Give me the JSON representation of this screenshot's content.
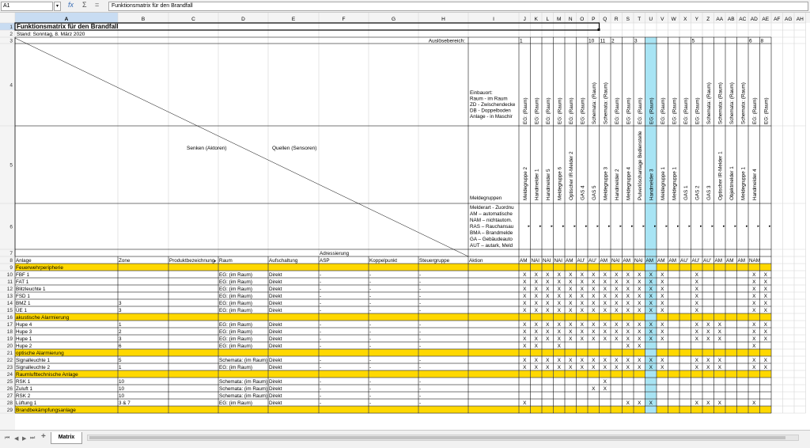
{
  "namebox": "A1",
  "formula": "Funktionsmatrix für den Brandfall",
  "tab": "Matrix",
  "columns": [
    "A",
    "B",
    "C",
    "D",
    "E",
    "F",
    "G",
    "H",
    "I",
    "J",
    "K",
    "L",
    "M",
    "N",
    "O",
    "P",
    "Q",
    "R",
    "S",
    "T",
    "U",
    "V",
    "W",
    "X",
    "Y",
    "Z",
    "AA",
    "AB",
    "AC",
    "AD",
    "AE",
    "AF",
    "AG",
    "AH"
  ],
  "selected_column": "A",
  "highlight_column": "U",
  "title": "Funktionsmatrix für den Brandfall",
  "stand": "Stand: Sonntag, 8. März 2020",
  "ausloese_label": "Auslösebereich:",
  "ausloese_values": {
    "J": "1",
    "P": "10",
    "Q": "11",
    "R": "2",
    "T": "3",
    "Y": "5",
    "AD": "6",
    "AE": "8"
  },
  "diag_labels": [
    "Senken (Aktoren)",
    "Quellen (Sensoren)"
  ],
  "einbauort": [
    "Einbauort:",
    "Raum - im Raum",
    "ZD - Zwischendecke",
    "DB - Doppelboden",
    "Anlage - in Maschir"
  ],
  "meldegruppen": "Meldegruppen",
  "melderart": [
    "Melderart - Zuordnu",
    "AM – automatische",
    "NAM – nichtautom.",
    "RAS – Rauchansau",
    "BMA – Brandmelde",
    "GA – Gebäudeauto",
    "AUT – autark, Meld"
  ],
  "adressierung": "Adressierung",
  "headers": {
    "A": "Anlage",
    "B": "Zone",
    "C": "Produktbezeichnung",
    "D": "Raum",
    "E": "Aufschaltung",
    "F": "ASP",
    "G": "Koppelpunkt",
    "H": "Steuergruppe",
    "I": "Aktion"
  },
  "row4": [
    "EG: (Raum)",
    "EG: (Raum)",
    "EG: (Raum)",
    "EG: (Raum)",
    "EG: (Raum)",
    "EG: (Raum)",
    "Schemata: (Raum)",
    "Schemata: (Raum)",
    "EG: (Raum)",
    "EG: (Raum)",
    "EG: (Raum)",
    "EG: (Raum)",
    "EG: (Raum)",
    "EG: (Raum)",
    "EG: (Raum)",
    "EG: (Raum)",
    "Schemata: (Raum)",
    "Schemata: (Raum)",
    "Schemata: (Raum)",
    "Schemata: (Raum)",
    "EG: (Raum)",
    "EG: (Raum)"
  ],
  "row5": [
    "Meldegruppe 2",
    "Handmelder 1",
    "Handmelder 5",
    "Meldegruppe 6",
    "Optischer IR-Melder 2",
    "GAS 4",
    "GAS 5",
    "Meldegruppe 3",
    "Handmelder 2",
    "Meldegruppe 4",
    "Pulverlöschanlage Bedienstelle",
    "Handmelder 3",
    "Meldegruppe 1",
    "Meldegruppe 1",
    "GAS 1",
    "GAS 2",
    "GAS 3",
    "Optischer IR-Melder 1",
    "Objektmelder 1",
    "Meldegruppe 1",
    "Handmelder 4"
  ],
  "row7": [
    "AM",
    "NAI",
    "NAI",
    "NAI",
    "AM",
    "AU'",
    "AU'",
    "AM",
    "NAI",
    "AM",
    "NAI",
    "AM",
    "AM",
    "AM",
    "AU'",
    "AU'",
    "AU'",
    "AM",
    "AM",
    "AM",
    "NAM"
  ],
  "rows": [
    {
      "n": "9",
      "section": "Feuerwehrperipherie"
    },
    {
      "n": "10",
      "A": "FBF 1",
      "D": "EG: (im Raum)",
      "E": "Direkt",
      "F": "-",
      "G": "-",
      "H": "-",
      "x": [
        "J",
        "K",
        "L",
        "M",
        "N",
        "O",
        "P",
        "Q",
        "R",
        "S",
        "T",
        "U",
        "V",
        "Y",
        "AD",
        "AE"
      ]
    },
    {
      "n": "11",
      "A": "FAT 1",
      "D": "EG: (im Raum)",
      "E": "Direkt",
      "F": "-",
      "G": "-",
      "H": "-",
      "x": [
        "J",
        "K",
        "L",
        "M",
        "N",
        "O",
        "P",
        "Q",
        "R",
        "S",
        "T",
        "U",
        "V",
        "Y",
        "AD",
        "AE"
      ]
    },
    {
      "n": "12",
      "A": "Blitzleuchte 1",
      "D": "EG: (im Raum)",
      "E": "Direkt",
      "F": "-",
      "G": "-",
      "H": "-",
      "x": [
        "J",
        "K",
        "L",
        "M",
        "N",
        "O",
        "P",
        "Q",
        "R",
        "S",
        "T",
        "U",
        "V",
        "Y",
        "AD",
        "AE"
      ]
    },
    {
      "n": "13",
      "A": "FSD 1",
      "D": "EG: (im Raum)",
      "E": "Direkt",
      "F": "-",
      "G": "-",
      "H": "-",
      "x": [
        "J",
        "K",
        "L",
        "M",
        "N",
        "O",
        "P",
        "Q",
        "R",
        "S",
        "T",
        "U",
        "V",
        "Y",
        "AD",
        "AE"
      ]
    },
    {
      "n": "14",
      "A": "BMZ 1",
      "B": "3",
      "D": "EG: (im Raum)",
      "E": "Direkt",
      "F": "-",
      "G": "-",
      "H": "-",
      "x": [
        "J",
        "K",
        "L",
        "M",
        "N",
        "O",
        "P",
        "Q",
        "R",
        "S",
        "T",
        "U",
        "V",
        "Y",
        "AD",
        "AE"
      ]
    },
    {
      "n": "15",
      "A": "ÜE 1",
      "B": "3",
      "D": "EG: (im Raum)",
      "E": "Direkt",
      "F": "-",
      "G": "-",
      "H": "-",
      "x": [
        "J",
        "K",
        "L",
        "M",
        "N",
        "O",
        "P",
        "Q",
        "R",
        "S",
        "T",
        "U",
        "V",
        "Y",
        "AD",
        "AE"
      ]
    },
    {
      "n": "16",
      "section": "akustische Alarmierung"
    },
    {
      "n": "17",
      "A": "Hupe 4",
      "B": "1",
      "D": "EG: (im Raum)",
      "E": "Direkt",
      "F": "-",
      "G": "-",
      "H": "-",
      "x": [
        "J",
        "K",
        "L",
        "M",
        "N",
        "O",
        "P",
        "Q",
        "R",
        "S",
        "T",
        "U",
        "V",
        "Y",
        "Z",
        "AA",
        "AD",
        "AE"
      ]
    },
    {
      "n": "18",
      "A": "Hupe 3",
      "B": "2",
      "D": "EG: (im Raum)",
      "E": "Direkt",
      "F": "-",
      "G": "-",
      "H": "-",
      "x": [
        "J",
        "K",
        "L",
        "M",
        "N",
        "O",
        "P",
        "Q",
        "R",
        "S",
        "T",
        "U",
        "V",
        "Y",
        "Z",
        "AA",
        "AD",
        "AE"
      ]
    },
    {
      "n": "19",
      "A": "Hupe 1",
      "B": "3",
      "D": "EG: (im Raum)",
      "E": "Direkt",
      "F": "-",
      "G": "-",
      "H": "-",
      "x": [
        "J",
        "K",
        "L",
        "M",
        "N",
        "O",
        "P",
        "Q",
        "R",
        "S",
        "T",
        "U",
        "V",
        "Y",
        "Z",
        "AA",
        "AD",
        "AE"
      ]
    },
    {
      "n": "20",
      "A": "Hupe 2",
      "B": "6",
      "D": "EG: (im Raum)",
      "E": "Direkt",
      "F": "-",
      "G": "-",
      "H": "-",
      "x": [
        "J",
        "K",
        "M",
        "S",
        "T",
        "AD"
      ]
    },
    {
      "n": "21",
      "section": "optische Alarmierung"
    },
    {
      "n": "22",
      "A": "Signalleuchte 1",
      "B": "5",
      "D": "Schemata: (im Raum)",
      "E": "Direkt",
      "F": "-",
      "G": "-",
      "H": "-",
      "x": [
        "J",
        "K",
        "L",
        "M",
        "N",
        "O",
        "P",
        "Q",
        "R",
        "S",
        "T",
        "U",
        "V",
        "Y",
        "Z",
        "AA",
        "AD",
        "AE"
      ]
    },
    {
      "n": "23",
      "A": "Signalleuchte 2",
      "B": "1",
      "D": "EG: (im Raum)",
      "E": "Direkt",
      "F": "-",
      "G": "-",
      "H": "-",
      "x": [
        "J",
        "K",
        "L",
        "M",
        "N",
        "O",
        "P",
        "Q",
        "R",
        "S",
        "T",
        "U",
        "V",
        "Y",
        "Z",
        "AA",
        "AD",
        "AE"
      ]
    },
    {
      "n": "24",
      "section": "Raumlufttechnische Anlage"
    },
    {
      "n": "25",
      "A": "RSK 1",
      "B": "10",
      "D": "Schemata: (im Raum)",
      "E": "Direkt",
      "F": "-",
      "G": "-",
      "H": "-",
      "x": [
        "Q"
      ]
    },
    {
      "n": "26",
      "A": "Zuluft 1",
      "B": "10",
      "D": "Schemata: (im Raum)",
      "E": "Direkt",
      "F": "-",
      "G": "-",
      "H": "-",
      "x": [
        "P",
        "Q"
      ]
    },
    {
      "n": "27",
      "A": "RSK 2",
      "B": "10",
      "D": "Schemata: (im Raum)",
      "E": "Direkt",
      "F": "-",
      "G": "-",
      "H": "-",
      "x": []
    },
    {
      "n": "28",
      "A": "Lüftung 1",
      "B": "3 & 7",
      "D": "EG: (im Raum)",
      "E": "Direkt",
      "F": "-",
      "G": "-",
      "H": "-",
      "x": [
        "J",
        "S",
        "T",
        "U",
        "Y",
        "Z",
        "AA",
        "AD"
      ]
    },
    {
      "n": "29",
      "section": "Brandbekämpfungsanlage"
    }
  ]
}
